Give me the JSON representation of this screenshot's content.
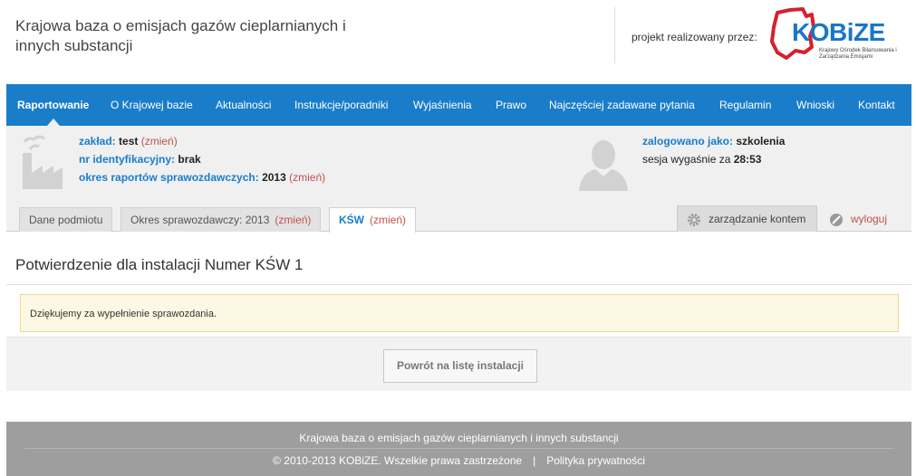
{
  "header": {
    "title": "Krajowa baza o emisjach gazów cieplarnianych i innych substancji",
    "project_label": "projekt realizowany przez:",
    "logo_word": "KOBiZE",
    "logo_sub": "Krajowy Ośrodek Bilansowania i Zarządzania Emisjami"
  },
  "nav": {
    "items": [
      {
        "label": "Raportowanie",
        "active": true
      },
      {
        "label": "O Krajowej bazie"
      },
      {
        "label": "Aktualności"
      },
      {
        "label": "Instrukcje/poradniki"
      },
      {
        "label": "Wyjaśnienia"
      },
      {
        "label": "Prawo"
      },
      {
        "label": "Najczęściej zadawane pytania"
      },
      {
        "label": "Regulamin"
      },
      {
        "label": "Wnioski"
      },
      {
        "label": "Kontakt"
      }
    ]
  },
  "info": {
    "zaklad_label": "zakład:",
    "zaklad_value": "test",
    "zmien": "(zmień)",
    "nr_label": "nr identyfikacyjny:",
    "nr_value": "brak",
    "okres_label": "okres raportów sprawozdawczych:",
    "okres_value": "2013",
    "logged_label": "zalogowano jako:",
    "logged_value": "szkolenia",
    "session_label": "sesja wygaśnie za",
    "session_value": "28:53"
  },
  "tabs": {
    "dane": "Dane podmiotu",
    "okres": "Okres sprawozdawczy: 2013",
    "ksw": "KŚW",
    "account": "zarządzanie kontem",
    "logout": "wyloguj"
  },
  "main": {
    "title": "Potwierdzenie dla instalacji Numer KŚW 1",
    "alert": "Dziękujemy za wypełnienie sprawozdania.",
    "back_button": "Powrót na listę instalacji"
  },
  "footer": {
    "title": "Krajowa baza o emisjach gazów cieplarnianych i innych substancji",
    "copyright": "© 2010-2013 KOBiZE. Wszelkie prawa zastrzeżone",
    "separator": "|",
    "privacy": "Polityka prywatności"
  },
  "colors": {
    "nav_blue": "#1a7dc9",
    "change_red": "#c0504d",
    "alert_bg": "#fcf8e3",
    "footer_gray": "#9e9e9e"
  }
}
